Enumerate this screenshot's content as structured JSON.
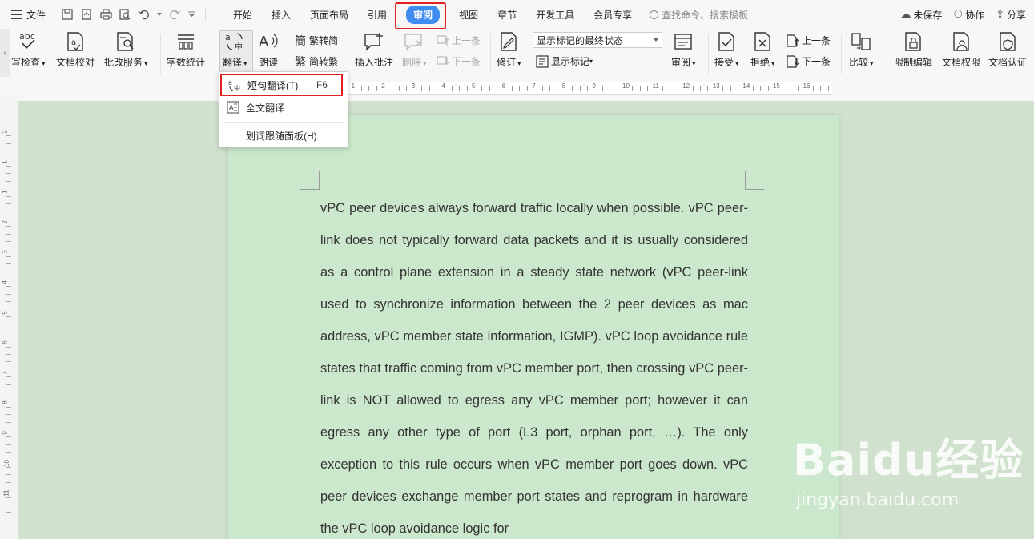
{
  "menubar": {
    "file_label": "文件",
    "tabs": [
      "开始",
      "插入",
      "页面布局",
      "引用",
      "审阅",
      "视图",
      "章节",
      "开发工具",
      "会员专享"
    ],
    "active_tab": "审阅",
    "search_placeholder": "查找命令、搜索模板",
    "right_actions": [
      "未保存",
      "协作",
      "分享"
    ]
  },
  "ribbon": {
    "spellcheck": "写检查",
    "doc_proof": "文档校对",
    "batch_service": "批改服务",
    "word_count": "字数统计",
    "translate": "翻译",
    "read_aloud": "朗读",
    "trad_to_simp": "繁转简",
    "simp_to_trad": "简转繁",
    "insert_comment": "插入批注",
    "delete": "删除",
    "prev": "上一条",
    "next": "下一条",
    "revise": "修订",
    "display_state": "显示标记的最终状态",
    "show_markup": "显示标记",
    "review": "审阅",
    "accept": "接受",
    "reject": "拒绝",
    "prev2": "上一条",
    "next2": "下一条",
    "compare": "比较",
    "restrict_edit": "限制编辑",
    "doc_rights": "文档权限",
    "doc_auth": "文档认证",
    "abc": "abc"
  },
  "dropdown": {
    "items": [
      {
        "label": "短句翻译(T)",
        "shortcut": "F6"
      },
      {
        "label": "全文翻译",
        "shortcut": ""
      },
      {
        "label": "划词跟随面板(H)",
        "shortcut": ""
      }
    ]
  },
  "ruler": {
    "numbers": [
      "1",
      "2",
      "3",
      "4",
      "5",
      "6",
      "7",
      "8",
      "9",
      "10",
      "11",
      "12",
      "13",
      "14",
      "15",
      "16",
      "17"
    ]
  },
  "vruler": {
    "numbers": [
      "2",
      "1",
      "1",
      "2",
      "3",
      "4",
      "5",
      "6",
      "7",
      "8",
      "9",
      "10",
      "11"
    ]
  },
  "document": {
    "paragraph": "vPC peer devices always forward traffic locally when possible. vPC peer-link does not typically forward data packets and it is usually considered as a control plane extension in a steady state network (vPC peer-link used to synchronize information between the 2 peer devices as mac address, vPC member state information, IGMP). vPC loop avoidance rule states that traffic coming from vPC member port, then crossing vPC peer-link is NOT allowed to egress any vPC member port; however it can egress any other type of port (L3 port, orphan port, …). The only exception to this rule occurs when vPC member port goes down. vPC peer devices exchange member port states and reprogram in hardware the vPC loop avoidance logic for"
  },
  "watermark": {
    "brand": "Baidu经验",
    "url": "jingyan.baidu.com"
  }
}
